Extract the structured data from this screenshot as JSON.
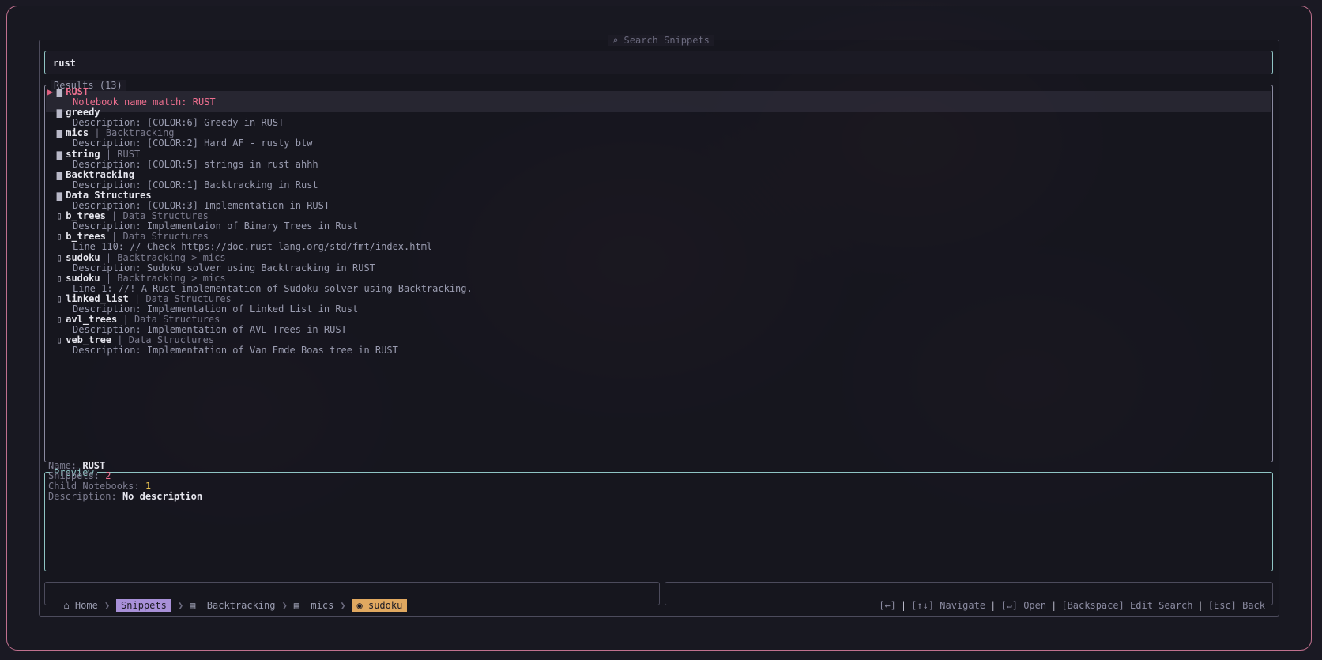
{
  "window": {
    "title": "Search Snippets"
  },
  "search": {
    "query": "rust"
  },
  "results": {
    "title": "Results (13)",
    "items": [
      {
        "name": "RUST",
        "path": "",
        "detail": "Notebook name match: RUST",
        "kind": "notebook",
        "selected": true
      },
      {
        "name": "greedy",
        "path": "",
        "detail": "Description: [COLOR:6] Greedy in RUST",
        "kind": "notebook"
      },
      {
        "name": "mics",
        "path": "| Backtracking",
        "detail": "Description: [COLOR:2] Hard AF - rusty btw",
        "kind": "notebook"
      },
      {
        "name": "string",
        "path": "| RUST",
        "detail": "Description: [COLOR:5] strings in rust ahhh",
        "kind": "notebook"
      },
      {
        "name": "Backtracking",
        "path": "",
        "detail": "Description: [COLOR:1] Backtracking in Rust",
        "kind": "notebook"
      },
      {
        "name": "Data Structures",
        "path": "",
        "detail": "Description: [COLOR:3] Implementation in RUST",
        "kind": "notebook"
      },
      {
        "name": "b_trees",
        "path": "| Data Structures",
        "detail": "Description: Implementaion of Binary Trees in Rust",
        "kind": "snippet"
      },
      {
        "name": "b_trees",
        "path": "| Data Structures",
        "detail": "Line 110: // Check https://doc.rust-lang.org/std/fmt/index.html",
        "kind": "snippet"
      },
      {
        "name": "sudoku",
        "path": "| Backtracking > mics",
        "detail": "Description: Sudoku solver using Backtracking in RUST",
        "kind": "snippet"
      },
      {
        "name": "sudoku",
        "path": "| Backtracking > mics",
        "detail": "Line 1: //! A Rust implementation of Sudoku solver using Backtracking.",
        "kind": "snippet"
      },
      {
        "name": "linked_list",
        "path": "| Data Structures",
        "detail": "Description: Implementation of Linked List in Rust",
        "kind": "snippet"
      },
      {
        "name": "avl_trees",
        "path": "| Data Structures",
        "detail": "Description: Implementation of AVL Trees in RUST",
        "kind": "snippet"
      },
      {
        "name": "veb_tree",
        "path": "| Data Structures",
        "detail": "Description: Implementation of Van Emde Boas tree in RUST",
        "kind": "snippet"
      }
    ]
  },
  "preview": {
    "title": "Preview",
    "name_label": "Name:",
    "name_value": "RUST",
    "snippets_label": "Snippets:",
    "snippets_value": "2",
    "children_label": "Child Notebooks:",
    "children_value": "1",
    "desc_label": "Description:",
    "desc_value": "No description"
  },
  "breadcrumb": {
    "home": "Home",
    "items": [
      "Snippets",
      "Backtracking",
      "mics",
      "sudoku"
    ]
  },
  "help": {
    "items": [
      "[←]",
      "[↑↓] Navigate",
      "[↵] Open",
      "[Backspace] Edit Search",
      "[Esc] Back"
    ]
  },
  "colors": {
    "accent_pink": "#ee6f8f",
    "border_teal": "#8fc4c4",
    "chip_purple": "#a890d8",
    "chip_orange": "#e0a860"
  }
}
